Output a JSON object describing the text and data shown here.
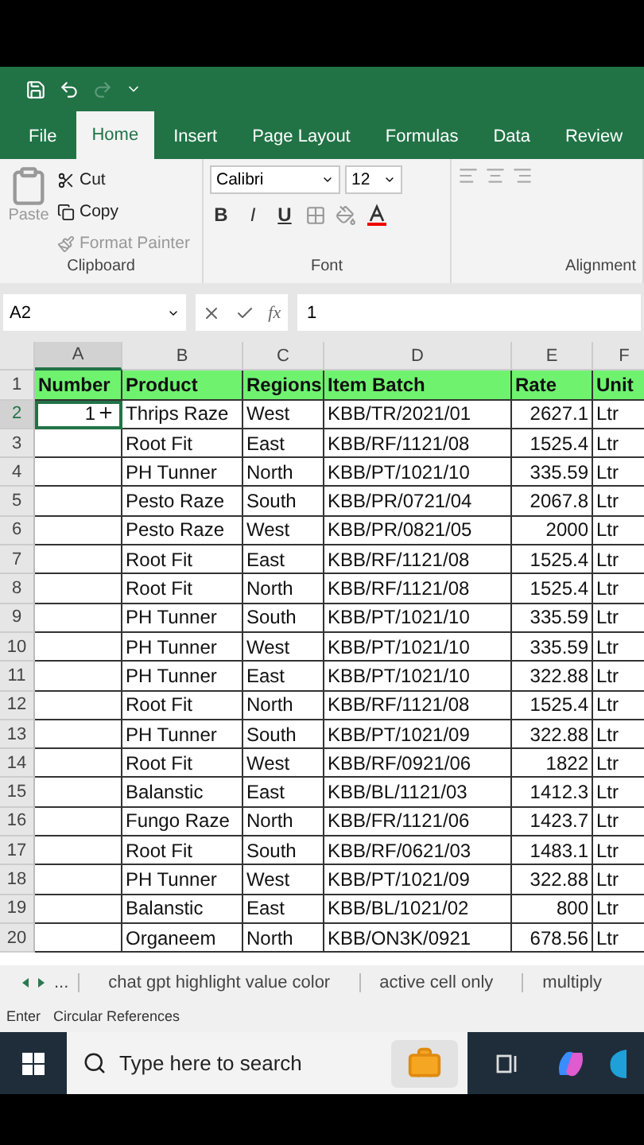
{
  "ribbon_tabs": [
    {
      "label": "File",
      "selected": false
    },
    {
      "label": "Home",
      "selected": true
    },
    {
      "label": "Insert",
      "selected": false
    },
    {
      "label": "Page Layout",
      "selected": false
    },
    {
      "label": "Formulas",
      "selected": false
    },
    {
      "label": "Data",
      "selected": false
    },
    {
      "label": "Review",
      "selected": false
    }
  ],
  "clipboard": {
    "paste": "Paste",
    "cut": "Cut",
    "copy": "Copy",
    "format_painter": "Format Painter",
    "group": "Clipboard"
  },
  "font": {
    "name": "Calibri",
    "size": "12",
    "bold": "B",
    "italic": "I",
    "underline": "U",
    "group": "Font"
  },
  "alignment": {
    "group": "Alignment"
  },
  "formula_bar": {
    "name_box": "A2",
    "fx": "fx",
    "value": "1"
  },
  "columns": [
    {
      "letter": "A",
      "selected": true
    },
    {
      "letter": "B",
      "selected": false
    },
    {
      "letter": "C",
      "selected": false
    },
    {
      "letter": "D",
      "selected": false
    },
    {
      "letter": "E",
      "selected": false
    },
    {
      "letter": "F",
      "selected": false
    }
  ],
  "header_row": {
    "row_number": "1",
    "cells": [
      "Number",
      "Product",
      "Regions",
      "Item Batch",
      "Rate",
      "Unit"
    ]
  },
  "row_numbers": [
    "2",
    "3",
    "4",
    "5",
    "6",
    "7",
    "8",
    "9",
    "10",
    "11",
    "12",
    "13",
    "14",
    "15",
    "16",
    "17",
    "18",
    "19",
    "20"
  ],
  "rows": [
    {
      "number": "1",
      "product": "Thrips Raze",
      "region": "West",
      "batch": "KBB/TR/2021/01",
      "rate": "2627.1",
      "unit": "Ltr",
      "selected": true
    },
    {
      "number": "",
      "product": "Root Fit",
      "region": "East",
      "batch": "KBB/RF/1121/08",
      "rate": "1525.4",
      "unit": "Ltr",
      "selected": false
    },
    {
      "number": "",
      "product": "PH Tunner",
      "region": "North",
      "batch": "KBB/PT/1021/10",
      "rate": "335.59",
      "unit": "Ltr",
      "selected": false
    },
    {
      "number": "",
      "product": "Pesto Raze",
      "region": "South",
      "batch": "KBB/PR/0721/04",
      "rate": "2067.8",
      "unit": "Ltr",
      "selected": false
    },
    {
      "number": "",
      "product": "Pesto Raze",
      "region": "West",
      "batch": "KBB/PR/0821/05",
      "rate": "2000",
      "unit": "Ltr",
      "selected": false
    },
    {
      "number": "",
      "product": "Root Fit",
      "region": "East",
      "batch": "KBB/RF/1121/08",
      "rate": "1525.4",
      "unit": "Ltr",
      "selected": false
    },
    {
      "number": "",
      "product": "Root Fit",
      "region": "North",
      "batch": "KBB/RF/1121/08",
      "rate": "1525.4",
      "unit": "Ltr",
      "selected": false
    },
    {
      "number": "",
      "product": "PH Tunner",
      "region": "South",
      "batch": "KBB/PT/1021/10",
      "rate": "335.59",
      "unit": "Ltr",
      "selected": false
    },
    {
      "number": "",
      "product": "PH Tunner",
      "region": "West",
      "batch": "KBB/PT/1021/10",
      "rate": "335.59",
      "unit": "Ltr",
      "selected": false
    },
    {
      "number": "",
      "product": "PH Tunner",
      "region": "East",
      "batch": "KBB/PT/1021/10",
      "rate": "322.88",
      "unit": "Ltr",
      "selected": false
    },
    {
      "number": "",
      "product": "Root Fit",
      "region": "North",
      "batch": "KBB/RF/1121/08",
      "rate": "1525.4",
      "unit": "Ltr",
      "selected": false
    },
    {
      "number": "",
      "product": "PH Tunner",
      "region": "South",
      "batch": "KBB/PT/1021/09",
      "rate": "322.88",
      "unit": "Ltr",
      "selected": false
    },
    {
      "number": "",
      "product": "Root Fit",
      "region": "West",
      "batch": "KBB/RF/0921/06",
      "rate": "1822",
      "unit": "Ltr",
      "selected": false
    },
    {
      "number": "",
      "product": "Balanstic",
      "region": "East",
      "batch": "KBB/BL/1121/03",
      "rate": "1412.3",
      "unit": "Ltr",
      "selected": false
    },
    {
      "number": "",
      "product": "Fungo Raze",
      "region": "North",
      "batch": "KBB/FR/1121/06",
      "rate": "1423.7",
      "unit": "Ltr",
      "selected": false
    },
    {
      "number": "",
      "product": "Root Fit",
      "region": "South",
      "batch": "KBB/RF/0621/03",
      "rate": "1483.1",
      "unit": "Ltr",
      "selected": false
    },
    {
      "number": "",
      "product": "PH Tunner",
      "region": "West",
      "batch": "KBB/PT/1021/09",
      "rate": "322.88",
      "unit": "Ltr",
      "selected": false
    },
    {
      "number": "",
      "product": "Balanstic",
      "region": "East",
      "batch": "KBB/BL/1021/02",
      "rate": "800",
      "unit": "Ltr",
      "selected": false
    },
    {
      "number": "",
      "product": "Organeem",
      "region": "North",
      "batch": "KBB/ON3K/0921",
      "rate": "678.56",
      "unit": "Ltr",
      "selected": false
    }
  ],
  "sheet_tabs": [
    {
      "label": "...",
      "selected": false
    },
    {
      "label": "chat gpt highlight value color",
      "selected": false
    },
    {
      "label": "active cell only",
      "selected": false
    },
    {
      "label": "multiply",
      "selected": false
    }
  ],
  "status_bar": [
    "Enter",
    "Circular References"
  ],
  "taskbar": {
    "search_placeholder": "Type here to search"
  }
}
